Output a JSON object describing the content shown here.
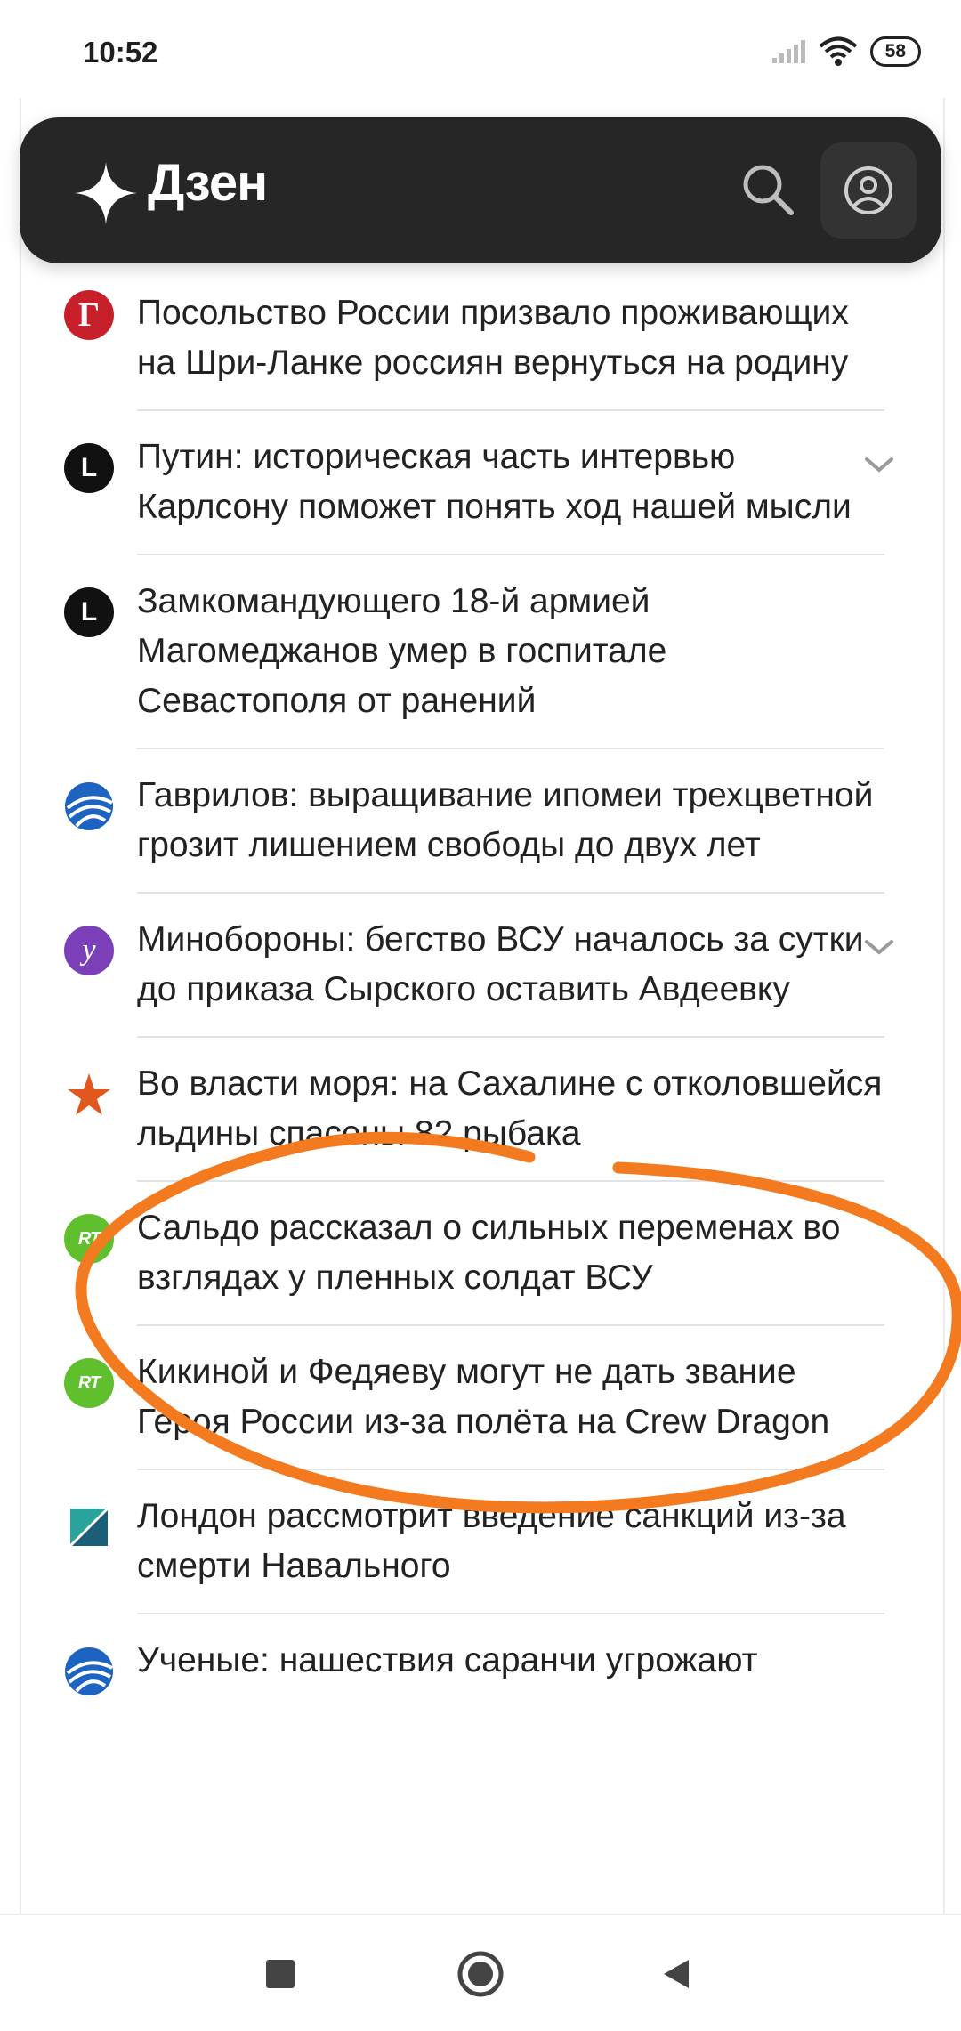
{
  "status_bar": {
    "time": "10:52",
    "battery": "58",
    "icons": [
      "signal-icon",
      "wifi-icon",
      "battery-icon"
    ]
  },
  "header": {
    "logo_text": "Дзен",
    "icons": [
      "dzen-star-icon",
      "search-icon",
      "profile-icon"
    ],
    "bg_color": "#262626"
  },
  "news": [
    {
      "source_icon": "gazeta-icon",
      "title": "Посольство России призвало проживающих на Шри-Ланке россиян вернуться на родину",
      "expandable": false
    },
    {
      "source_icon": "l-source-icon",
      "title": "Путин: историческая часть интервью Карлсону поможет понять ход нашей мысли",
      "expandable": true
    },
    {
      "source_icon": "l-source-icon",
      "title": "Замкомандующего 18-й армией Магомеджанов умер в госпитале Севастополя от ранений",
      "expandable": false
    },
    {
      "source_icon": "globe-source-icon",
      "title": "Гаврилов: выращивание ипомеи трехцветной грозит лишением свободы до двух лет",
      "expandable": false
    },
    {
      "source_icon": "y-source-icon",
      "title": "Минобороны: бегство ВСУ началось за сутки до приказа Сырского оставить Авдеевку",
      "expandable": true
    },
    {
      "source_icon": "star-source-icon",
      "title": "Во власти моря: на Сахалине с отколовшейся льдины спасены 82 рыбака",
      "expandable": false
    },
    {
      "source_icon": "rt-source-icon",
      "title": "Сальдо рассказал о сильных переменах во взглядах у пленных солдат ВСУ",
      "expandable": false
    },
    {
      "source_icon": "rt-source-icon",
      "title": "Кикиной и Федяеву могут не дать звание Героя России из-за полёта на Crew Dragon",
      "expandable": false
    },
    {
      "source_icon": "dk-source-icon",
      "title": "Лондон рассмотрит введение санкций из-за смерти Навального",
      "expandable": false
    },
    {
      "source_icon": "globe-source-icon",
      "title": "Ученые: нашествия саранчи угрожают",
      "expandable": false
    }
  ],
  "nav_bar": {
    "icons": [
      "recents-icon",
      "home-icon",
      "back-icon"
    ]
  },
  "annotation": {
    "color": "#f47a20",
    "shape": "freehand-circle"
  }
}
